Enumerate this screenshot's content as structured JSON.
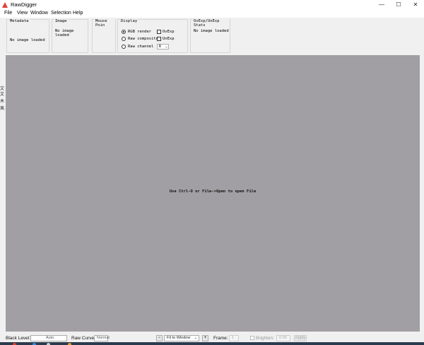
{
  "window": {
    "title": "RawDigger",
    "minimize_glyph": "—",
    "maximize_glyph": "☐",
    "close_glyph": "✕"
  },
  "menu": [
    "File",
    "View",
    "Window",
    "Selection",
    "Help"
  ],
  "left_edge_glyphs": [
    "文",
    "文",
    "木",
    "夷"
  ],
  "panels": {
    "metadata": {
      "title": "Metadata",
      "text": "No image loaded"
    },
    "image": {
      "title": "Image",
      "text": "No image loaded"
    },
    "mouse": {
      "title": "Mouse Poin"
    },
    "display": {
      "title": "Display",
      "options": [
        {
          "label": "RGB render",
          "selected": true
        },
        {
          "label": "Raw composite",
          "selected": false
        },
        {
          "label": "Raw channel",
          "selected": false
        }
      ],
      "checks": [
        {
          "label": "OvExp",
          "checked": false
        },
        {
          "label": "UnExp",
          "checked": false
        }
      ],
      "channel_value": "R",
      "dropdown_arrow": "⌄"
    },
    "ovexp": {
      "title": "OvExp/UnExp Stats",
      "text": "No image loaded"
    }
  },
  "canvas_message": "Use Ctrl-O or File->Open to open File",
  "bottom": {
    "black_level_label": "Black Level:",
    "black_level_value": "Auto",
    "raw_curve_label": "Raw Curve:",
    "raw_curve_value": "Normal",
    "minus": "−",
    "zoom_value": "Fit to Window",
    "zoom_arrow": "⌄",
    "plus": "+",
    "frame_label": "Frame:",
    "frame_value": "1",
    "brighten_label": "Brighten:",
    "brighten_value": "0.00",
    "apply_label": "Apply"
  },
  "colors": {
    "canvas": "#a19fa3",
    "panel": "#f0f0f0",
    "app_icon": "#e0423a"
  }
}
